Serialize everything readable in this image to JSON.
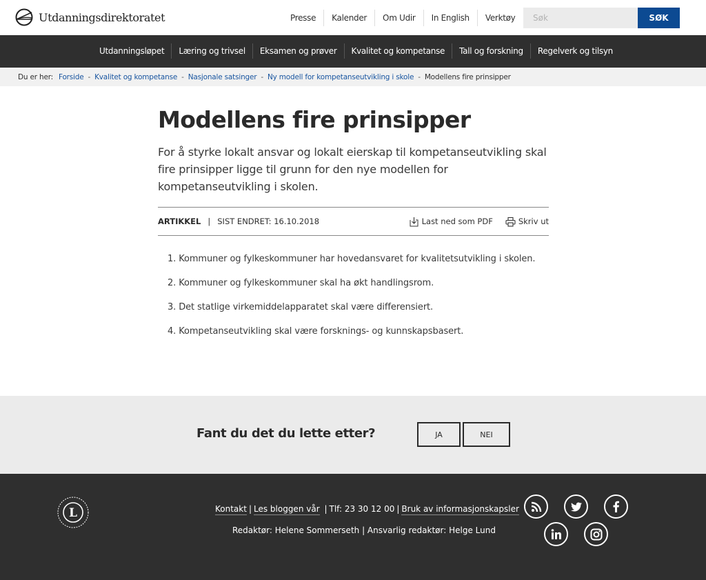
{
  "header": {
    "logo_text": "Utdanningsdirektoratet",
    "top_links": [
      "Presse",
      "Kalender",
      "Om Udir",
      "In English",
      "Verktøy"
    ],
    "search": {
      "placeholder": "Søk",
      "value": "",
      "button_label": "SØK"
    },
    "accent_color": "#0c4a92"
  },
  "main_nav": [
    "Utdanningsløpet",
    "Læring og trivsel",
    "Eksamen og prøver",
    "Kvalitet og kompetanse",
    "Tall og forskning",
    "Regelverk og tilsyn"
  ],
  "breadcrumb": {
    "label": "Du er her:",
    "links": [
      "Forside",
      "Kvalitet og kompetanse",
      "Nasjonale satsinger",
      "Ny modell for kompetanseutvikling i skole"
    ],
    "current": "Modellens fire prinsipper",
    "separator": "-"
  },
  "article": {
    "title": "Modellens fire prinsipper",
    "lead": "For å styrke lokalt ansvar og lokalt eierskap til kompetanseutvikling skal fire prinsipper ligge til grunn for den nye modellen for kompetanseutvikling i skolen.",
    "type": "ARTIKKEL",
    "divider": "|",
    "last_changed": "SIST ENDRET: 16.10.2018",
    "download_label": "Last ned som PDF",
    "print_label": "Skriv ut",
    "principles": [
      "1. Kommuner og fylkeskommuner har hovedansvaret for kvalitetsutvikling i skolen.",
      "2. Kommuner og fylkeskommuner skal ha økt handlingsrom.",
      "3. Det statlige virkemiddelapparatet skal være differensiert.",
      "4. Kompetanseutvikling skal være forsknings- og kunnskapsbasert."
    ]
  },
  "feedback": {
    "question": "Fant du det du lette etter?",
    "yes_label": "JA",
    "no_label": "NEI"
  },
  "footer": {
    "links": [
      "Kontakt",
      "Les bloggen vår",
      "Bruk av informasjonskapsler"
    ],
    "phone": "Tlf: 23 30 12 00",
    "editors": "Redaktør: Helene Sommerseth | Ansvarlig redaktør: Helge Lund",
    "badge_letter": "L",
    "social": [
      "rss-icon",
      "twitter-icon",
      "facebook-icon",
      "linkedin-icon",
      "instagram-icon"
    ]
  }
}
